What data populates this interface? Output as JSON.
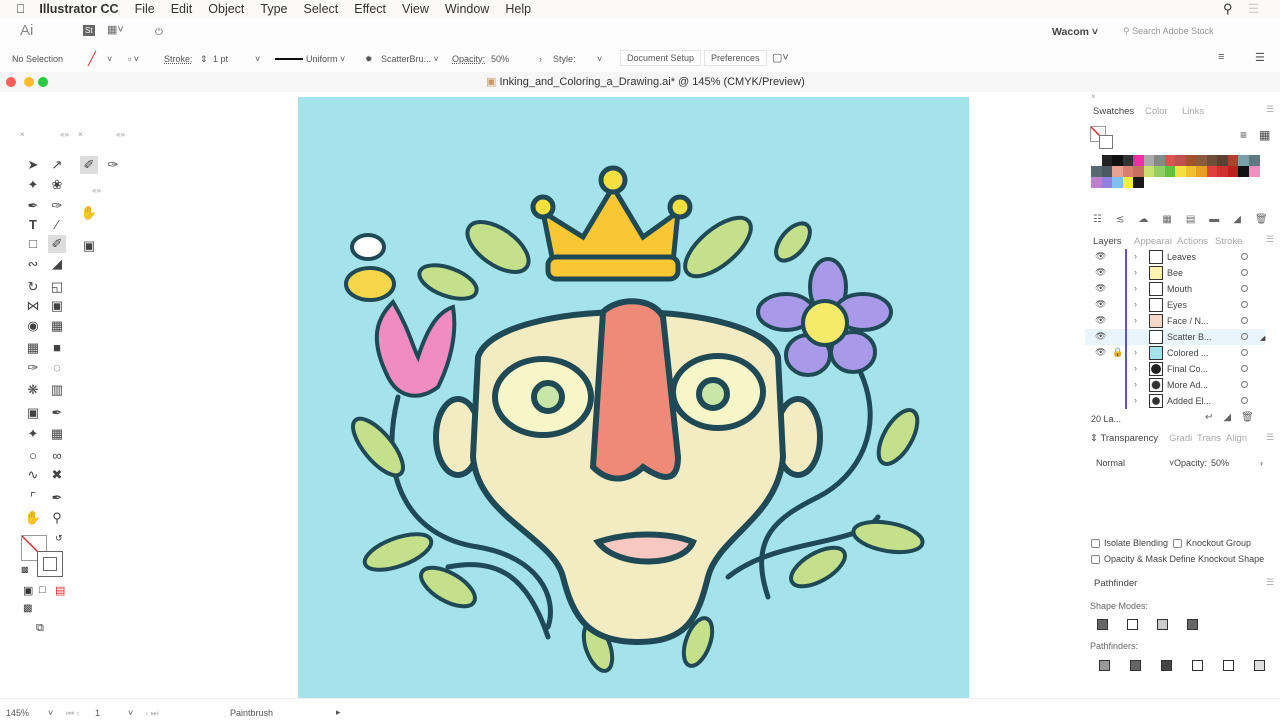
{
  "menubar": {
    "app": "Illustrator CC",
    "items": [
      "File",
      "Edit",
      "Object",
      "Type",
      "Select",
      "Effect",
      "View",
      "Window",
      "Help"
    ]
  },
  "appbar": {
    "logo": "Ai",
    "stock_badge": "St",
    "workspace": "Wacom",
    "search_placeholder": "Search Adobe Stock"
  },
  "control": {
    "selection": "No Selection",
    "stroke_label": "Stroke:",
    "stroke_value": "1 pt",
    "profile": "Uniform",
    "brush": "ScatterBru...",
    "opacity_label": "Opacity:",
    "opacity_value": "50%",
    "style_label": "Style:",
    "doc_setup": "Document Setup",
    "preferences": "Preferences"
  },
  "document": {
    "title": "Inking_and_Coloring_a_Drawing.ai* @ 145% (CMYK/Preview)",
    "canvas_color": "#a3e3e9"
  },
  "swatches_panel": {
    "tabs": [
      "Swatches",
      "Color",
      "Links"
    ],
    "colors": [
      "#ffffff",
      "#222222",
      "#111111",
      "#333333",
      "#ee2fa6",
      "#aaaaaa",
      "#888888",
      "#d9534f",
      "#c0504d",
      "#a0522d",
      "#8b5a3c",
      "#6f4e37",
      "#5c4033",
      "#b04030",
      "#7aa0a8",
      "#607880",
      "#556b70",
      "#4a5a60",
      "#e8a090",
      "#d88070",
      "#c87060",
      "#c8e070",
      "#90d060",
      "#60c040",
      "#f3e040",
      "#f0c030",
      "#e8a020",
      "#e04040",
      "#d03030",
      "#c02020",
      "#111111",
      "#f090c0",
      "#c080d0",
      "#9080e0",
      "#80c0f0",
      "#f5f040",
      "#1a1a1a"
    ]
  },
  "layers_panel": {
    "tabs": [
      "Layers",
      "Appearai",
      "Actions",
      "Stroke"
    ],
    "layers": [
      {
        "name": "Leaves"
      },
      {
        "name": "Bee"
      },
      {
        "name": "Mouth"
      },
      {
        "name": "Eyes"
      },
      {
        "name": "Face / N..."
      },
      {
        "name": "Scatter B..."
      },
      {
        "name": "Colored ..."
      },
      {
        "name": "Final Co..."
      },
      {
        "name": "More Ad..."
      },
      {
        "name": "Added El..."
      }
    ],
    "count": "20 La..."
  },
  "transparency_panel": {
    "tabs": [
      "Transparency",
      "Gradi",
      "Trans",
      "Align"
    ],
    "blend_mode": "Normal",
    "opacity_label": "Opacity:",
    "opacity_value": "50%",
    "isolate": "Isolate Blending",
    "knockout": "Knockout Group",
    "opacity_mask": "Opacity & Mask Define Knockout Shape"
  },
  "pathfinder_panel": {
    "title": "Pathfinder",
    "shape_modes": "Shape Modes:",
    "pathfinders": "Pathfinders:"
  },
  "statusbar": {
    "zoom": "145%",
    "artboard": "1",
    "tool": "Paintbrush"
  }
}
